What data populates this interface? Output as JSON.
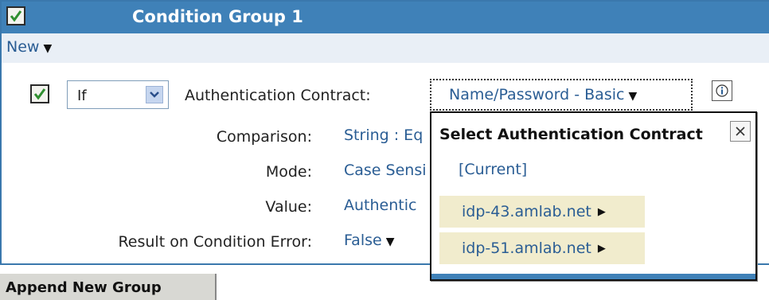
{
  "group": {
    "title": "Condition Group 1",
    "checked": true
  },
  "new_menu": {
    "label": "New"
  },
  "condition": {
    "operator": "If",
    "contract_label": "Authentication Contract:",
    "contract_value": "Name/Password - Basic",
    "comparison_label": "Comparison:",
    "comparison_value": "String : Eq",
    "mode_label": "Mode:",
    "mode_value": "Case Sensi",
    "value_label": "Value:",
    "value_value": "Authentic",
    "error_label": "Result on Condition Error:",
    "error_value": "False"
  },
  "popup": {
    "title": "Select Authentication Contract",
    "current": "[Current]",
    "items": [
      "idp-43.amlab.net",
      "idp-51.amlab.net"
    ]
  },
  "append_button": "Append New Group",
  "colors": {
    "header": "#3f81b8",
    "link": "#2a5d94",
    "highlight": "#f1eccd",
    "checkmark": "#2f8f2f"
  }
}
